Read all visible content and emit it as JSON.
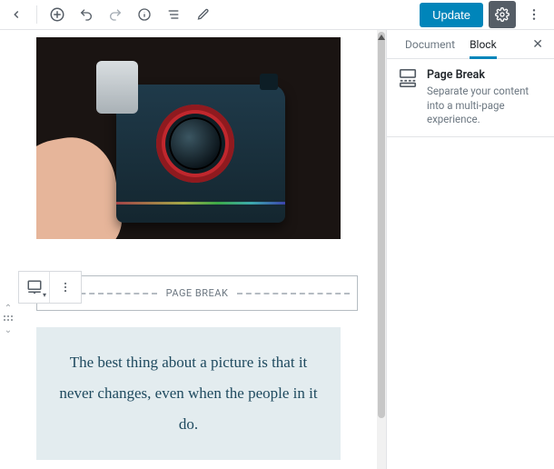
{
  "toolbar": {
    "update_label": "Update"
  },
  "sidebar": {
    "tabs": {
      "document": "Document",
      "block": "Block"
    },
    "card": {
      "title": "Page Break",
      "description": "Separate your content into a multi-page experience."
    }
  },
  "editor": {
    "page_break_label": "PAGE BREAK",
    "quote_text": "The best thing about a picture is that it never changes, even when the people in it do."
  }
}
